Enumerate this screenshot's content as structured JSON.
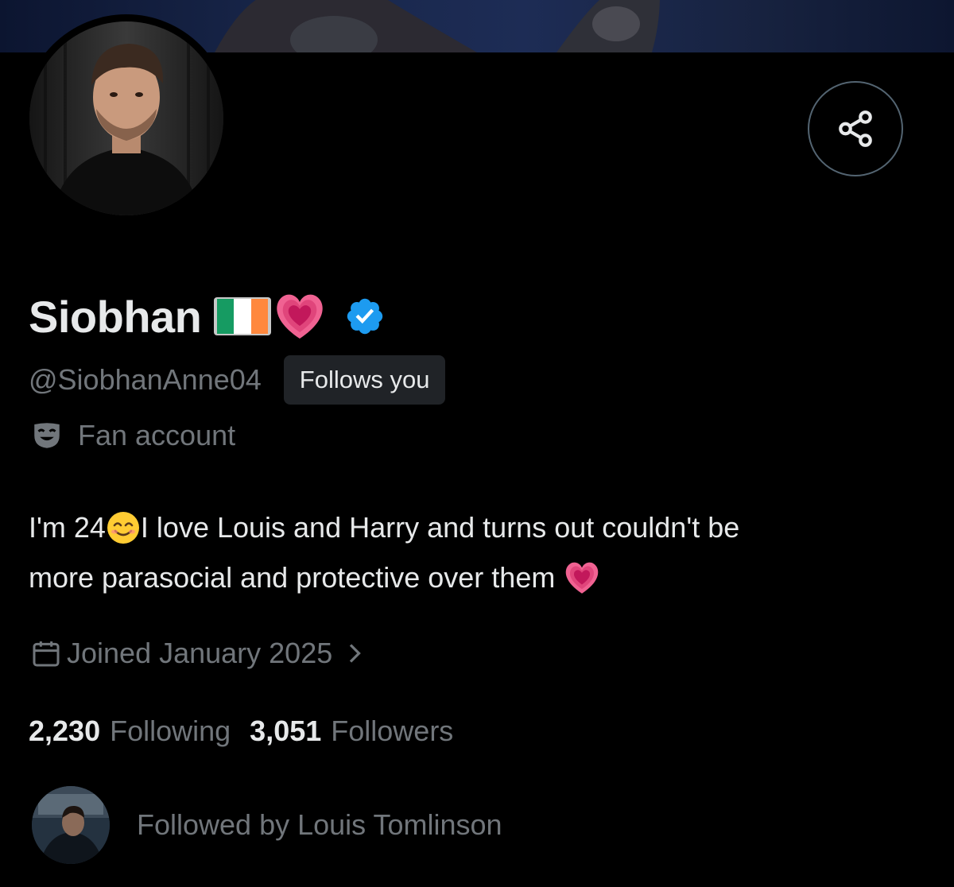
{
  "profile": {
    "display_name": "Siobhan",
    "handle": "@SiobhanAnne04",
    "follows_you": "Follows you",
    "category": "Fan account",
    "bio_line1_a": "I'm 24",
    "bio_line1_b": " I love Louis and Harry and turns out couldn't be",
    "bio_line2": "more parasocial and protective over them ",
    "joined": "Joined January 2025",
    "following_count": "2,230",
    "following_label": "Following",
    "followers_count": "3,051",
    "followers_label": "Followers",
    "followed_by": "Followed by Louis Tomlinson"
  },
  "icons": {
    "share": "share-icon",
    "verified": "verified-badge-icon",
    "category": "theater-mask-icon",
    "calendar": "calendar-icon",
    "chevron": "chevron-right-icon",
    "flag": "ireland-flag-emoji",
    "heart": "growing-heart-emoji",
    "smile": "smiling-face-emoji"
  },
  "colors": {
    "background": "#000000",
    "primary_text": "#e7e9ea",
    "secondary_text": "#71767b",
    "verified_blue": "#1d9bf0",
    "badge_bg": "#202327",
    "heart_pink": "#e0457b"
  }
}
